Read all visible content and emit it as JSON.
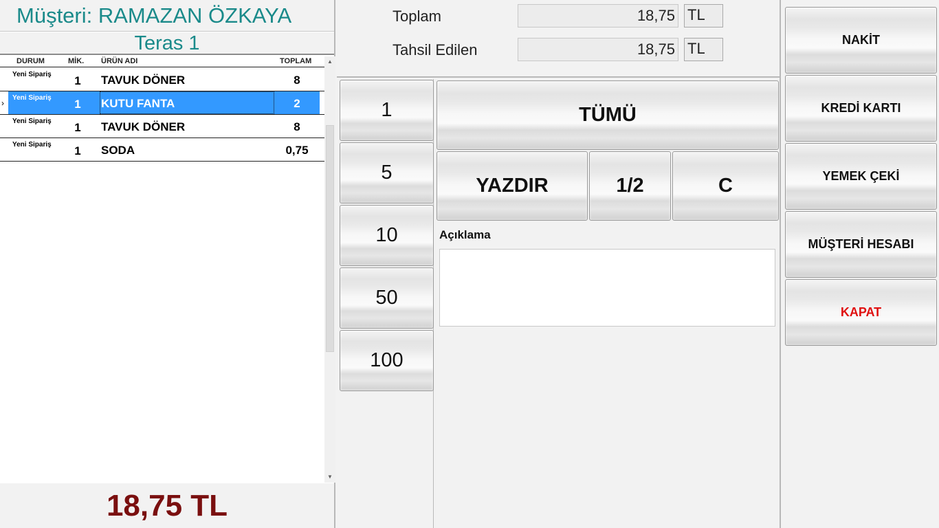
{
  "order": {
    "customer_title": "Müşteri: RAMAZAN ÖZKAYA",
    "table_name": "Teras 1",
    "columns": {
      "durum": "DURUM",
      "mik": "MİK.",
      "urun": "ÜRÜN ADI",
      "toplam": "TOPLAM"
    },
    "rows": [
      {
        "durum": "Yeni Sipariş",
        "mik": "1",
        "urun": "TAVUK DÖNER",
        "toplam": "8"
      },
      {
        "durum": "Yeni Sipariş",
        "mik": "1",
        "urun": "KUTU FANTA",
        "toplam": "2"
      },
      {
        "durum": "Yeni Sipariş",
        "mik": "1",
        "urun": "TAVUK DÖNER",
        "toplam": "8"
      },
      {
        "durum": "Yeni Sipariş",
        "mik": "1",
        "urun": "SODA",
        "toplam": "0,75"
      }
    ],
    "selected_row_marker": "›",
    "grand_total": "18,75 TL"
  },
  "summary": {
    "toplam_label": "Toplam",
    "toplam_value": "18,75",
    "toplam_unit": "TL",
    "tahsil_label": "Tahsil Edilen",
    "tahsil_value": "18,75",
    "tahsil_unit": "TL"
  },
  "keypad": {
    "denominations": [
      "1",
      "5",
      "10",
      "50",
      "100"
    ],
    "all_label": "TÜMÜ",
    "print_label": "YAZDIR",
    "half_label": "1/2",
    "clear_label": "C"
  },
  "description": {
    "label": "Açıklama",
    "value": ""
  },
  "payments": {
    "cash": "NAKİT",
    "credit_card": "KREDİ KARTI",
    "meal_voucher": "YEMEK ÇEKİ",
    "customer_account": "MÜŞTERİ HESABI",
    "close": "KAPAT"
  },
  "colors": {
    "title_teal": "#1a8a8a",
    "selection_blue": "#3399ff",
    "total_maroon": "#7a0f0f",
    "close_red": "#e01010"
  }
}
